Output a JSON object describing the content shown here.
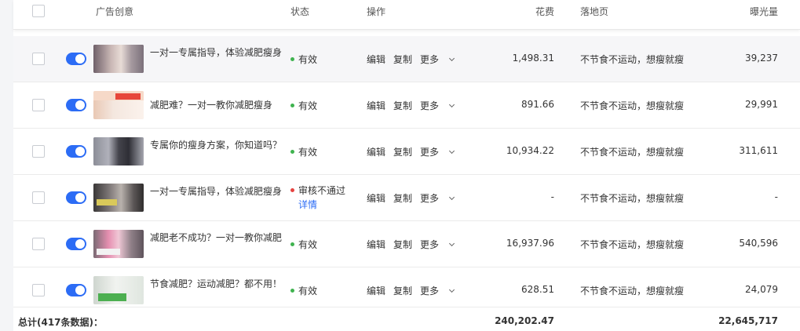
{
  "header": {
    "creative": "广告创意",
    "status": "状态",
    "actions": "操作",
    "spend": "花费",
    "landing": "落地页",
    "impressions": "曝光量"
  },
  "actions": {
    "edit": "编辑",
    "copy": "复制",
    "more": "更多"
  },
  "colors": {
    "accent": "#2c6cf5",
    "status_valid": "#3fb34f",
    "status_rejected": "#e64340"
  },
  "rows": [
    {
      "title": "一对一专属指导，体验减肥瘦身",
      "status": "有效",
      "status_detail": "",
      "spend": "1,498.31",
      "landing": "不节食不运动，想瘦就瘦",
      "impressions": "39,237",
      "enabled": true
    },
    {
      "title": "减肥难？一对一教你减肥瘦身",
      "status": "有效",
      "status_detail": "",
      "spend": "891.66",
      "landing": "不节食不运动，想瘦就瘦",
      "impressions": "29,991",
      "enabled": true
    },
    {
      "title": "专属你的瘦身方案，你知道吗？",
      "status": "有效",
      "status_detail": "",
      "spend": "10,934.22",
      "landing": "不节食不运动，想瘦就瘦",
      "impressions": "311,611",
      "enabled": true
    },
    {
      "title": "一对一专属指导，体验减肥瘦身",
      "status": "审核不通过",
      "status_detail": "详情",
      "spend": "-",
      "landing": "不节食不运动，想瘦就瘦",
      "impressions": "-",
      "enabled": true
    },
    {
      "title": "减肥老不成功？一对一教你减肥",
      "status": "有效",
      "status_detail": "",
      "spend": "16,937.96",
      "landing": "不节食不运动，想瘦就瘦",
      "impressions": "540,596",
      "enabled": true
    },
    {
      "title": "节食减肥？运动减肥？都不用！",
      "status": "有效",
      "status_detail": "",
      "spend": "628.51",
      "landing": "不节食不运动，想瘦就瘦",
      "impressions": "24,079",
      "enabled": true
    }
  ],
  "footer": {
    "label": "总计(417条数据)：",
    "total_spend": "240,202.47",
    "total_impressions": "22,645,717"
  }
}
